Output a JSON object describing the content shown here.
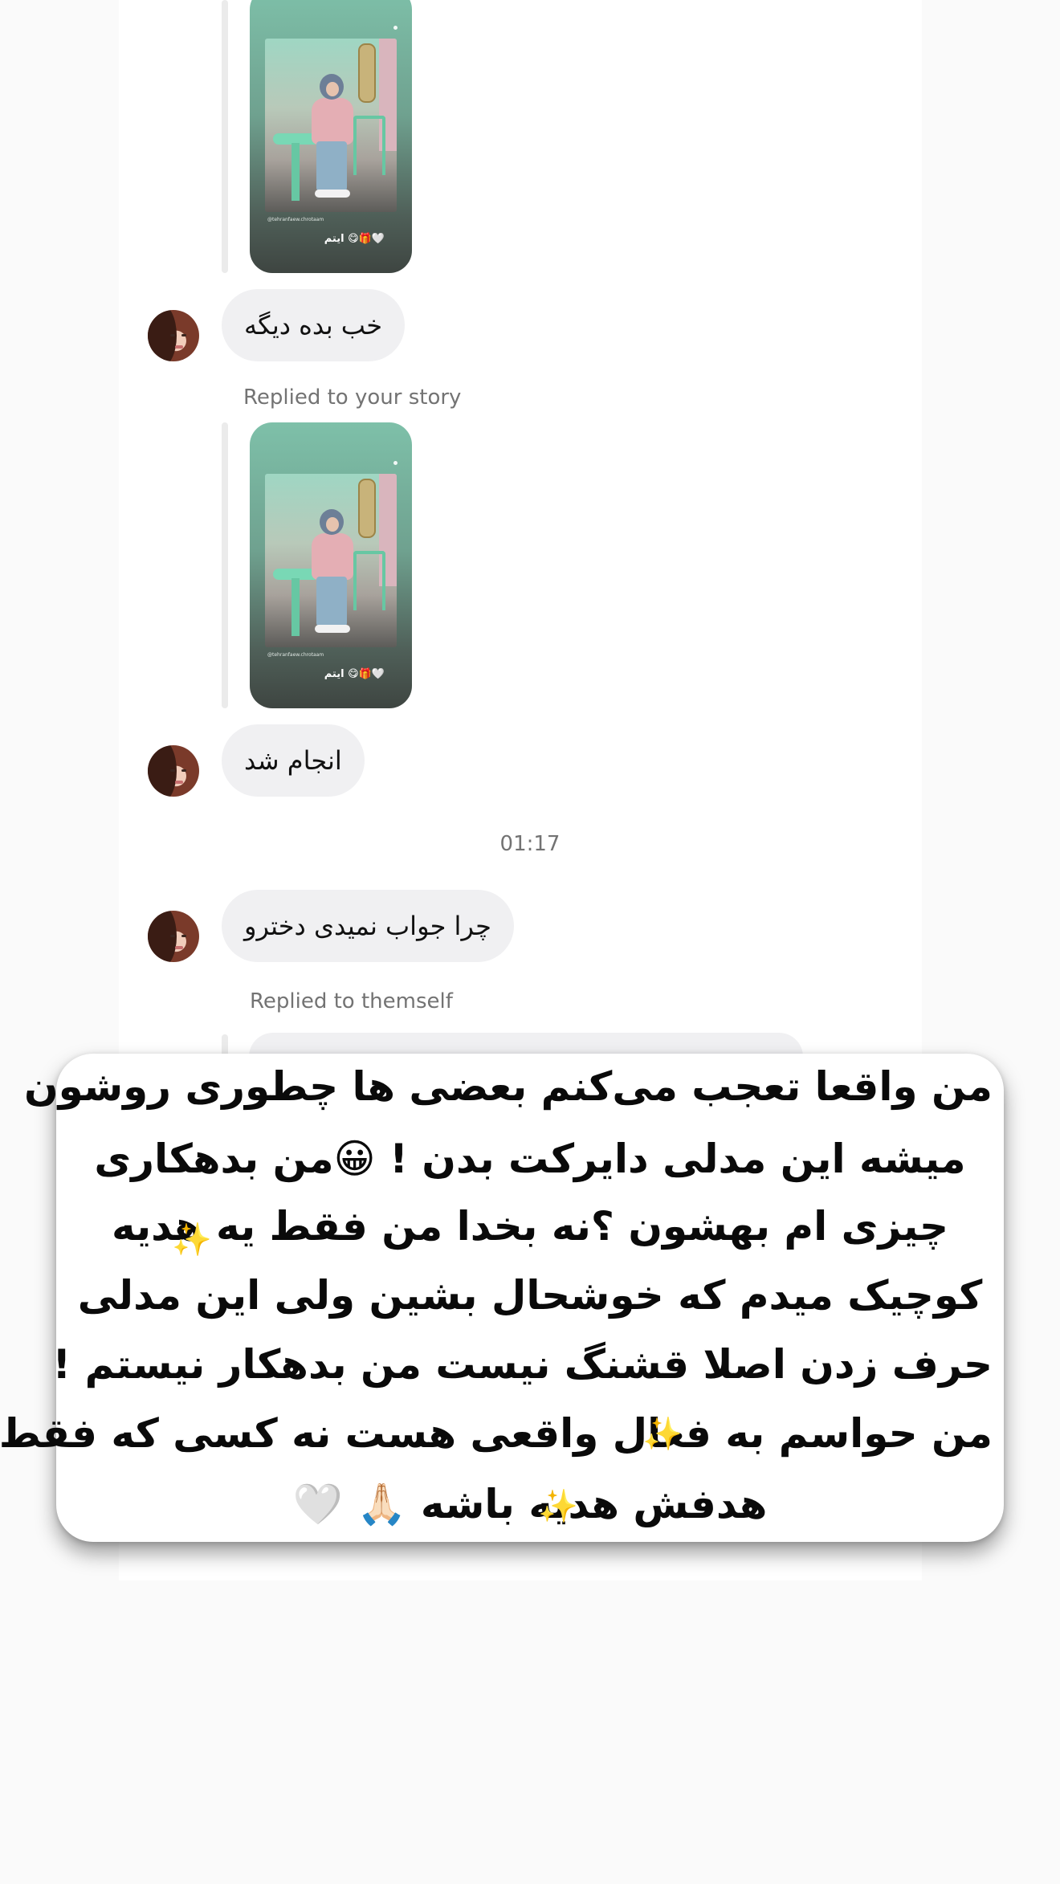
{
  "messages": [
    {
      "type": "story",
      "caption": "ایتم 😋🎁🤍",
      "handle": "@tehranfaew.chrotaam"
    },
    {
      "type": "text",
      "text": "خب بده دیگه"
    },
    {
      "type": "meta",
      "text": "Replied to your story"
    },
    {
      "type": "story",
      "caption": "ایتم 😋🎁🤍",
      "handle": "@tehranfaew.chrotaam"
    },
    {
      "type": "text",
      "text": "انجام شد"
    },
    {
      "type": "timestamp",
      "text": "01:17"
    },
    {
      "type": "text",
      "text": "چرا جواب نمیدی دخترو"
    },
    {
      "type": "meta",
      "text": "Replied to themself"
    }
  ],
  "overlay": {
    "lines": [
      "من واقعا تعجب می‌کنم بعضی ها چطوری روشون",
      "میشه این مدلی دایرکت بدن ! 😀من بدهکاری",
      "چیزی ام بهشون ؟نه بخدا من فقط یه هدیه",
      "کوچیک میدم که خوشحال بشین ولی این مدلی",
      "حرف زدن اصلا قشنگ نیست من بدهکار نیستم !",
      "من حواسم به فعال واقعی هست نه کسی که فقط",
      "هدفش هدیه باشه 🙏🏻 🤍"
    ],
    "sparkle_icon": "✨"
  },
  "colors": {
    "bubble": "#f0f0f2",
    "meta_text": "#737373",
    "story_top": "#7ec0a9",
    "story_bottom": "#3e4541"
  }
}
